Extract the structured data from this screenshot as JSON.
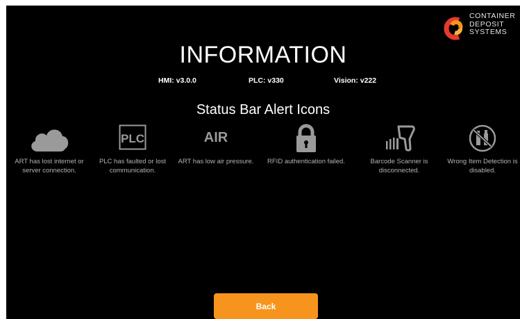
{
  "logo": {
    "line1": "CONTAINER",
    "line2": "DEPOSIT",
    "line3": "SYSTEMS"
  },
  "title": "INFORMATION",
  "versions": {
    "hmi": "HMI: v3.0.0",
    "plc": "PLC: v330",
    "vision": "Vision: v222"
  },
  "subtitle": "Status Bar Alert Icons",
  "alerts": [
    {
      "icon": "cloud-icon",
      "label": "ART has lost internet or server connection."
    },
    {
      "icon": "plc-icon",
      "icon_text": "PLC",
      "label": "PLC has faulted or lost communication."
    },
    {
      "icon": "air-icon",
      "icon_text": "AIR",
      "label": "ART has low air pressure."
    },
    {
      "icon": "lock-icon",
      "label": "RFID authentication failed."
    },
    {
      "icon": "barcode-scanner-icon",
      "label": "Barcode Scanner is disconnected."
    },
    {
      "icon": "no-bottles-icon",
      "label": "Wrong Item Detection is disabled."
    }
  ],
  "back_label": "Back",
  "colors": {
    "background": "#000000",
    "accent": "#f7941d",
    "icon_gray": "#9a9a9a",
    "logo_red": "#e53b2c",
    "logo_orange": "#f7941d"
  }
}
